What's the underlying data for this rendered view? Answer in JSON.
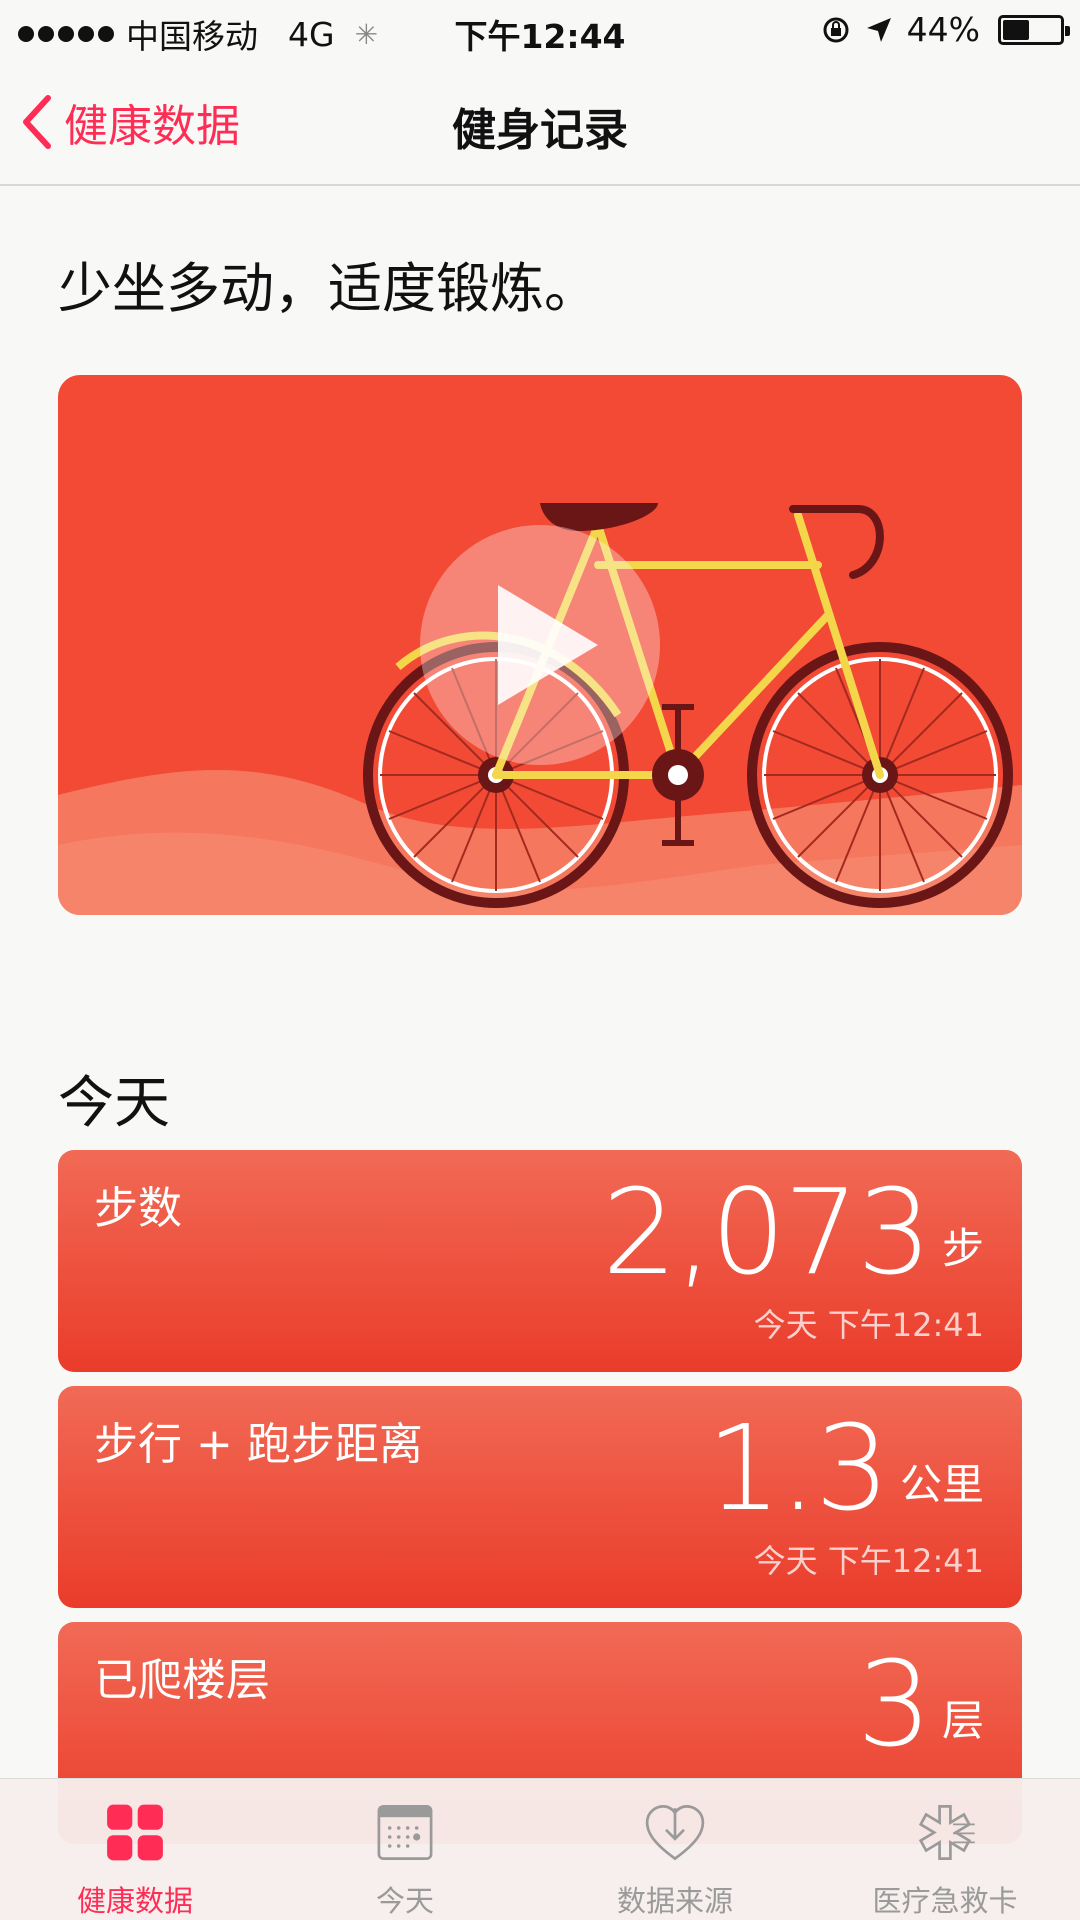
{
  "status_bar": {
    "carrier": "中国移动",
    "network": "4G",
    "time": "下午12:44",
    "battery": "44%"
  },
  "nav": {
    "back_label": "健康数据",
    "title": "健身记录"
  },
  "headline": "少坐多动，适度锻炼。",
  "section_title": "今天",
  "metrics": [
    {
      "label": "步数",
      "value": "2,073",
      "unit": "步",
      "timestamp": "今天 下午12:41"
    },
    {
      "label": "步行 + 跑步距离",
      "value": "1.3",
      "unit": "公里",
      "timestamp": "今天 下午12:41"
    },
    {
      "label": "已爬楼层",
      "value": "3",
      "unit": "层",
      "timestamp": ""
    }
  ],
  "tabs": [
    {
      "label": "健康数据",
      "icon": "grid-icon",
      "active": true
    },
    {
      "label": "今天",
      "icon": "calendar-icon",
      "active": false
    },
    {
      "label": "数据来源",
      "icon": "heart-download-icon",
      "active": false
    },
    {
      "label": "医疗急救卡",
      "icon": "medical-star-icon",
      "active": false
    }
  ],
  "colors": {
    "accent": "#ff2d55",
    "card_red": "#ea3c2b",
    "hero_bg": "#f24a35"
  }
}
